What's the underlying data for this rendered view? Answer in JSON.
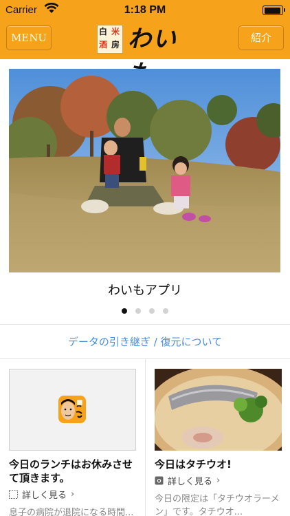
{
  "status_bar": {
    "carrier": "Carrier",
    "time": "1:18 PM"
  },
  "nav": {
    "menu_label": "MENU",
    "intro_label": "紹介",
    "logo": {
      "stamp_chars": [
        "白",
        "米",
        "酒",
        "房"
      ],
      "script_text": "わいも"
    },
    "background_color": "#f7a21b"
  },
  "hero": {
    "title": "わいもアプリ",
    "slide_count": 4,
    "active_slide": 1
  },
  "transfer_link": "データの引き継ぎ / 復元について",
  "cards": [
    {
      "title": "今日のランチはお休みさせて頂きます。",
      "more_label": "詳しく見る",
      "snippet": "息子の病院が退院になる時間..."
    },
    {
      "title": "今日はタチウオ!",
      "more_label": "詳しく見る",
      "snippet": "今日の限定は「タチウオラーメン」です。タチウオ..."
    }
  ],
  "colors": {
    "accent": "#f7a21b",
    "link": "#4a8ed8"
  }
}
